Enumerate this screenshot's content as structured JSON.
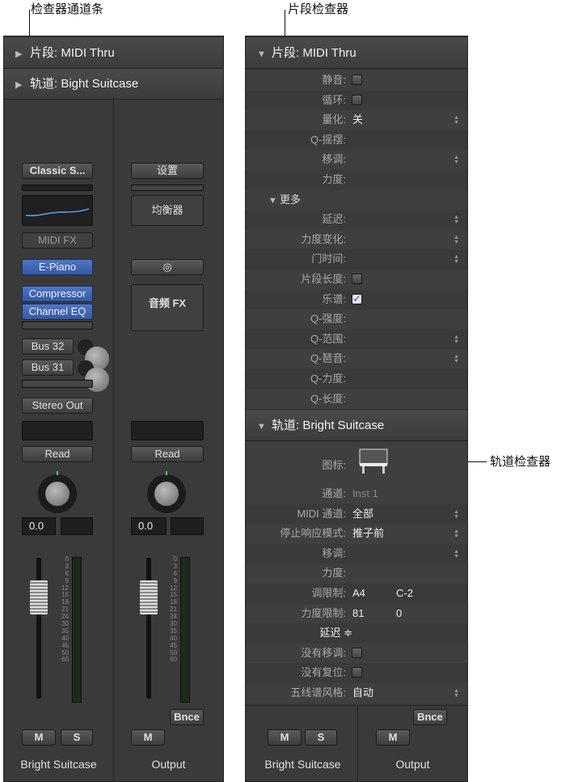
{
  "callouts": {
    "strip": "检查器通道条",
    "region": "片段检查器",
    "track": "轨道检查器"
  },
  "left": {
    "region_header": "片段: MIDI Thru",
    "track_header": "轨道: Bight Suitcase",
    "ch1": {
      "instrument": "Classic S...",
      "midifx": "MIDI FX",
      "plugin": "E-Piano",
      "fx1": "Compressor",
      "fx2": "Channel EQ",
      "send1": "Bus 32",
      "send2": "Bus 31",
      "output": "Stereo Out",
      "automation": "Read",
      "value": "0.0",
      "mute": "M",
      "solo": "S",
      "name": "Bright Suitcase"
    },
    "ch2": {
      "settings": "设置",
      "eq": "均衡器",
      "audiofx": "音频 FX",
      "automation": "Read",
      "value": "0.0",
      "bounce": "Bnce",
      "mute": "M",
      "name": "Output"
    },
    "scale": [
      "0",
      "3",
      "6",
      "9",
      "12",
      "15",
      "18",
      "21",
      "24",
      "30",
      "35",
      "40",
      "45",
      "50",
      "60"
    ]
  },
  "right": {
    "region_header": "片段: MIDI Thru",
    "region_rows": [
      {
        "label": "静音:",
        "value": "",
        "check": "off"
      },
      {
        "label": "循环:",
        "value": "",
        "check": "off"
      },
      {
        "label": "量化:",
        "value": "关",
        "spin": "true"
      },
      {
        "label": "Q-摇摆:",
        "value": ""
      },
      {
        "label": "移调:",
        "value": "",
        "spin": "true"
      },
      {
        "label": "力度:",
        "value": ""
      },
      {
        "label": "",
        "value": "",
        "more": "true"
      },
      {
        "label": "延迟:",
        "value": "",
        "spin": "true"
      },
      {
        "label": "力度变化:",
        "value": "",
        "spin": "true"
      },
      {
        "label": "门时间:",
        "value": "",
        "spin": "true"
      },
      {
        "label": "片段长度:",
        "value": "",
        "check": "off"
      },
      {
        "label": "乐谱:",
        "value": "",
        "check": "on"
      },
      {
        "label": "Q-强度:",
        "value": ""
      },
      {
        "label": "Q-范围:",
        "value": "",
        "spin": "true"
      },
      {
        "label": "Q-琶音:",
        "value": "",
        "spin": "true"
      },
      {
        "label": "Q-力度:",
        "value": ""
      },
      {
        "label": "Q-长度:",
        "value": ""
      }
    ],
    "more_label": "更多",
    "track_header": "轨道: Bright Suitcase",
    "icon_label": "图标:",
    "track_rows": [
      {
        "label": "通道:",
        "value": "Inst 1",
        "dim": "true"
      },
      {
        "label": "MIDI 通道:",
        "value": "全部",
        "spin": "true"
      },
      {
        "label": "停止响应模式:",
        "value": "推子前",
        "spin": "true"
      },
      {
        "label": "移调:",
        "value": "",
        "spin": "true"
      },
      {
        "label": "力度:",
        "value": ""
      },
      {
        "label": "调限制:",
        "value": "A4",
        "value2": "C-2"
      },
      {
        "label": "力度限制:",
        "value": "81",
        "value2": "0"
      },
      {
        "label": "延迟 ≑",
        "value": "",
        "center": "true"
      },
      {
        "label": "没有移调:",
        "value": "",
        "check": "off"
      },
      {
        "label": "没有复位:",
        "value": "",
        "check": "off"
      },
      {
        "label": "五线谱风格:",
        "value": "自动",
        "spin": "true"
      }
    ],
    "ch1": {
      "mute": "M",
      "solo": "S",
      "name": "Bright Suitcase"
    },
    "ch2": {
      "bounce": "Bnce",
      "mute": "M",
      "name": "Output"
    }
  }
}
